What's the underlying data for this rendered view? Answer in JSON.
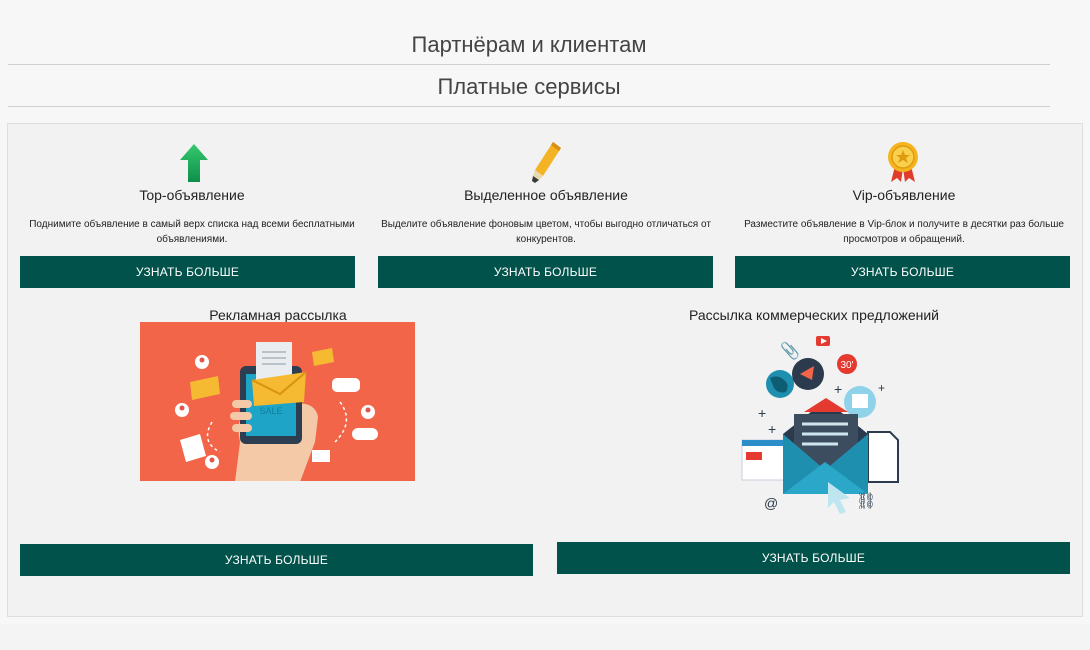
{
  "headings": {
    "partners": "Партнёрам и клиентам",
    "paid_services": "Платные сервисы"
  },
  "services": [
    {
      "icon": "green-arrow-up-icon",
      "title": "Top-объявление",
      "description": "Поднимите объявление в самый верх списка над всеми бесплатными объявлениями.",
      "button": "УЗНАТЬ БОЛЬШЕ"
    },
    {
      "icon": "highlighter-pen-icon",
      "title": "Выделенное объявление",
      "description": "Выделите объявление фоновым цветом, чтобы выгодно отличаться от конкурентов.",
      "button": "УЗНАТЬ БОЛЬШЕ"
    },
    {
      "icon": "gold-medal-icon",
      "title": "Vip-объявление",
      "description": "Разместите объявление в Vip-блок и получите в десятки раз больше просмотров и обращений.",
      "button": "УЗНАТЬ БОЛЬШЕ"
    }
  ],
  "mailings": [
    {
      "title": "Рекламная рассылка",
      "illustration": "hand-with-tablet-illustration",
      "button": "УЗНАТЬ БОЛЬШЕ"
    },
    {
      "title": "Рассылка коммерческих предложений",
      "illustration": "email-envelope-illustration",
      "button": "УЗНАТЬ БОЛЬШЕ"
    }
  ],
  "colors": {
    "button_bg": "#00524a",
    "promo_bg": "#f26549",
    "accent_green": "#19a862",
    "gold": "#f2b01e"
  }
}
